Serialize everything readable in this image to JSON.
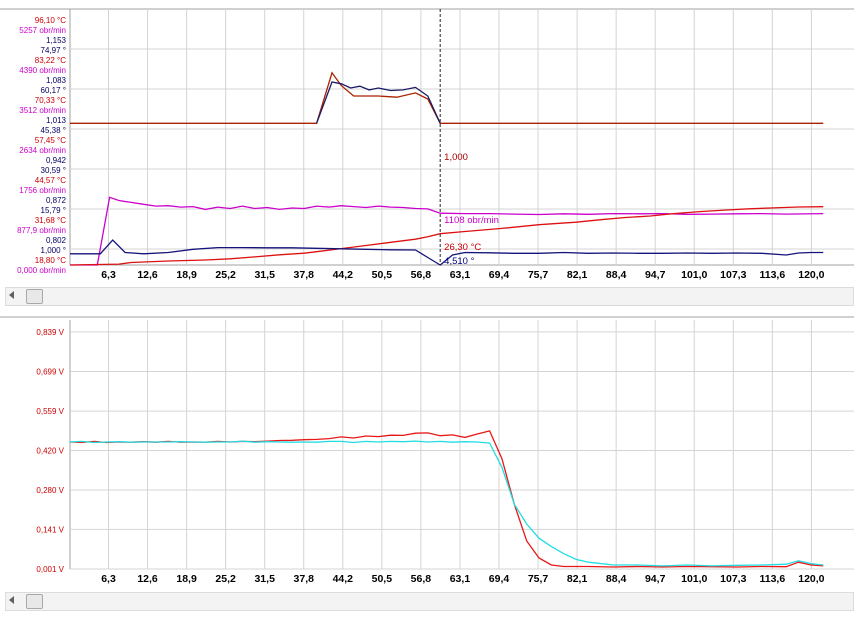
{
  "chart_data": [
    {
      "type": "line",
      "x_ticks": [
        "6,3",
        "12,6",
        "18,9",
        "25,2",
        "31,5",
        "37,8",
        "44,2",
        "50,5",
        "56,8",
        "63,1",
        "69,4",
        "75,7",
        "82,1",
        "88,4",
        "94,7",
        "101,0",
        "107,3",
        "113,6",
        "120,0"
      ],
      "x_range": [
        0,
        122
      ],
      "grid": true,
      "cursor_x": 60.0,
      "y_labels": [
        {
          "text": "96,10 °C",
          "color": "#cc0000"
        },
        {
          "text": "5257 obr/min",
          "color": "#cc00cc"
        },
        {
          "text": "1,153",
          "color": "#000060"
        },
        {
          "text": "74,97 °",
          "color": "#000060"
        },
        {
          "text": "83,22 °C",
          "color": "#cc0000"
        },
        {
          "text": "4390 obr/min",
          "color": "#cc00cc"
        },
        {
          "text": "1,083",
          "color": "#000060"
        },
        {
          "text": "60,17 °",
          "color": "#000060"
        },
        {
          "text": "70,33 °C",
          "color": "#cc0000"
        },
        {
          "text": "3512 obr/min",
          "color": "#cc00cc"
        },
        {
          "text": "1,013",
          "color": "#000060"
        },
        {
          "text": "45,38 °",
          "color": "#000060"
        },
        {
          "text": "57,45 °C",
          "color": "#cc0000"
        },
        {
          "text": "2634 obr/min",
          "color": "#cc00cc"
        },
        {
          "text": "0,942",
          "color": "#000060"
        },
        {
          "text": "30,59 °",
          "color": "#000060"
        },
        {
          "text": "44,57 °C",
          "color": "#cc0000"
        },
        {
          "text": "1756 obr/min",
          "color": "#cc00cc"
        },
        {
          "text": "0,872",
          "color": "#000060"
        },
        {
          "text": "15,79 °",
          "color": "#000060"
        },
        {
          "text": "31,68 °C",
          "color": "#cc0000"
        },
        {
          "text": "877,9 obr/min",
          "color": "#cc00cc"
        },
        {
          "text": "0,802",
          "color": "#000060"
        },
        {
          "text": "1,000 °",
          "color": "#000060"
        },
        {
          "text": "18,80 °C",
          "color": "#cc0000"
        },
        {
          "text": "0,000 obr/min",
          "color": "#cc00cc"
        }
      ],
      "cursor_labels": [
        {
          "text": "1,000",
          "color": "#aa0000",
          "series": "lambda"
        },
        {
          "text": "1108 obr/min",
          "color": "#cc00cc",
          "series": "rpm"
        },
        {
          "text": "26,30 °C",
          "color": "#cc0000",
          "series": "temp"
        },
        {
          "text": "4,510 °",
          "color": "#000080",
          "series": "angle"
        }
      ],
      "series": [
        {
          "key": "lambda",
          "color": "#aa2200",
          "range": [
            0.767,
            1.188
          ],
          "x": [
            0,
            40,
            42.5,
            44,
            46,
            50,
            53,
            56,
            58,
            60,
            122
          ],
          "y": [
            1.0,
            1.0,
            1.083,
            1.062,
            1.045,
            1.045,
            1.043,
            1.05,
            1.04,
            1.0,
            1.0
          ]
        },
        {
          "key": "lambda2",
          "color": "#1a1a66",
          "range": [
            0.767,
            1.188
          ],
          "x": [
            40,
            42.5,
            44,
            45.5,
            47,
            48.5,
            50,
            52,
            54,
            56,
            58,
            60
          ],
          "y": [
            1.0,
            1.068,
            1.065,
            1.058,
            1.061,
            1.055,
            1.058,
            1.054,
            1.055,
            1.059,
            1.045,
            1.0
          ]
        },
        {
          "key": "rpm",
          "color": "#cc00cc",
          "range": [
            0,
            5479
          ],
          "x": [
            0,
            4.5,
            6.5,
            8,
            10,
            12,
            14,
            16,
            18,
            20,
            22,
            24,
            26,
            28,
            30,
            32,
            34,
            36,
            38,
            40,
            42,
            44,
            46,
            48,
            50,
            52,
            54,
            56,
            58,
            60,
            64,
            68,
            72,
            76,
            80,
            84,
            88,
            92,
            96,
            100,
            104,
            108,
            112,
            116,
            122
          ],
          "y": [
            0,
            0,
            1450,
            1380,
            1340,
            1300,
            1260,
            1270,
            1240,
            1250,
            1190,
            1240,
            1210,
            1260,
            1210,
            1230,
            1190,
            1220,
            1210,
            1260,
            1240,
            1270,
            1250,
            1230,
            1260,
            1240,
            1230,
            1210,
            1200,
            1108,
            1100,
            1100,
            1090,
            1080,
            1095,
            1085,
            1100,
            1095,
            1100,
            1085,
            1090,
            1095,
            1100,
            1090,
            1100
          ]
        },
        {
          "key": "temp",
          "color": "#dd1111",
          "range": [
            16.2,
            98.7
          ],
          "x": [
            0,
            8,
            10,
            16,
            22,
            26,
            30,
            34,
            38,
            40,
            44,
            48,
            52,
            56,
            58,
            60,
            64,
            70,
            76,
            82,
            86,
            90,
            94,
            98,
            102,
            106,
            110,
            114,
            118,
            122
          ],
          "y": [
            16.2,
            16.5,
            17.0,
            17.5,
            17.8,
            18.2,
            18.8,
            19.5,
            20.0,
            20.5,
            21.5,
            22.5,
            23.5,
            24.5,
            25.3,
            26.3,
            27.0,
            28.0,
            29.2,
            30.0,
            30.8,
            31.5,
            32.0,
            32.8,
            33.4,
            33.9,
            34.3,
            34.6,
            34.9,
            35.0
          ]
        },
        {
          "key": "angle",
          "color": "#14147a",
          "range": [
            -3.5,
            99.2
          ],
          "x": [
            0,
            5,
            7,
            9,
            12,
            16,
            20,
            24,
            28,
            32,
            36,
            40,
            44,
            48,
            52,
            56,
            58,
            60,
            62,
            64,
            68,
            72,
            76,
            80,
            84,
            88,
            92,
            96,
            100,
            104,
            108,
            112,
            116,
            118,
            120,
            122
          ],
          "y": [
            1.0,
            1.0,
            6.5,
            1.5,
            1.0,
            1.5,
            2.8,
            3.5,
            3.5,
            3.4,
            3.4,
            3.2,
            3.0,
            2.8,
            2.6,
            2.5,
            -0.5,
            -3.5,
            0.5,
            1.5,
            1.4,
            1.2,
            1.2,
            1.5,
            1.2,
            1.3,
            1.2,
            1.2,
            1.3,
            1.2,
            1.3,
            1.2,
            0.5,
            1.3,
            1.5,
            1.5
          ]
        }
      ]
    },
    {
      "type": "line",
      "x_ticks": [
        "6,3",
        "12,6",
        "18,9",
        "25,2",
        "31,5",
        "37,8",
        "44,2",
        "50,5",
        "56,8",
        "63,1",
        "69,4",
        "75,7",
        "82,1",
        "88,4",
        "94,7",
        "101,0",
        "107,3",
        "113,6",
        "120,0"
      ],
      "x_range": [
        0,
        122
      ],
      "ylim": [
        0.001,
        0.881
      ],
      "y_ticks": [
        {
          "value": 0.839,
          "text": "0,839 V"
        },
        {
          "value": 0.699,
          "text": "0,699 V"
        },
        {
          "value": 0.559,
          "text": "0,559 V"
        },
        {
          "value": 0.42,
          "text": "0,420 V"
        },
        {
          "value": 0.28,
          "text": "0,280 V"
        },
        {
          "value": 0.141,
          "text": "0,141 V"
        },
        {
          "value": 0.001,
          "text": "0,001 V"
        }
      ],
      "grid": true,
      "series": [
        {
          "color": "#e81818",
          "x": [
            0,
            2,
            4,
            6,
            8,
            10,
            12,
            14,
            16,
            18,
            20,
            22,
            24,
            26,
            28,
            30,
            32,
            34,
            36,
            38,
            40,
            42,
            44,
            46,
            48,
            50,
            52,
            54,
            56,
            58,
            60,
            62,
            64,
            66,
            68,
            70,
            72,
            74,
            76,
            78,
            80,
            84,
            88,
            92,
            96,
            100,
            104,
            108,
            112,
            116,
            118,
            120,
            122
          ],
          "y": [
            0.45,
            0.448,
            0.452,
            0.448,
            0.45,
            0.449,
            0.451,
            0.449,
            0.452,
            0.449,
            0.45,
            0.449,
            0.452,
            0.45,
            0.452,
            0.451,
            0.453,
            0.455,
            0.456,
            0.458,
            0.459,
            0.462,
            0.468,
            0.464,
            0.471,
            0.469,
            0.474,
            0.473,
            0.481,
            0.482,
            0.472,
            0.475,
            0.466,
            0.478,
            0.489,
            0.39,
            0.23,
            0.1,
            0.04,
            0.015,
            0.01,
            0.01,
            0.008,
            0.01,
            0.008,
            0.01,
            0.009,
            0.008,
            0.01,
            0.009,
            0.025,
            0.015,
            0.012
          ]
        },
        {
          "color": "#22dde0",
          "x": [
            0,
            2,
            4,
            6,
            8,
            10,
            12,
            14,
            16,
            18,
            20,
            22,
            24,
            26,
            28,
            30,
            32,
            34,
            36,
            38,
            40,
            42,
            44,
            46,
            48,
            50,
            52,
            54,
            56,
            58,
            60,
            62,
            64,
            66,
            68,
            70,
            72,
            74,
            76,
            78,
            80,
            82,
            84,
            88,
            92,
            96,
            100,
            104,
            108,
            112,
            116,
            118,
            120,
            122
          ],
          "y": [
            0.45,
            0.452,
            0.448,
            0.45,
            0.451,
            0.449,
            0.45,
            0.45,
            0.45,
            0.451,
            0.45,
            0.449,
            0.45,
            0.45,
            0.453,
            0.449,
            0.451,
            0.45,
            0.449,
            0.45,
            0.449,
            0.452,
            0.452,
            0.448,
            0.452,
            0.45,
            0.452,
            0.451,
            0.453,
            0.45,
            0.452,
            0.449,
            0.451,
            0.45,
            0.446,
            0.36,
            0.23,
            0.16,
            0.11,
            0.08,
            0.055,
            0.035,
            0.025,
            0.015,
            0.015,
            0.012,
            0.015,
            0.012,
            0.014,
            0.015,
            0.018,
            0.03,
            0.02,
            0.015
          ]
        }
      ]
    }
  ]
}
